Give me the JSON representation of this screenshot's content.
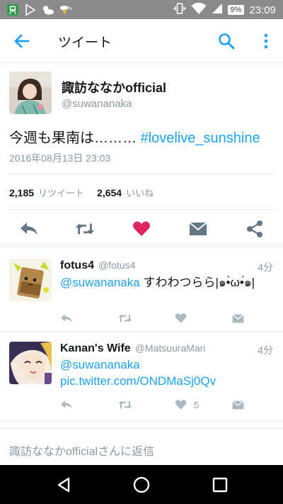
{
  "status_bar": {
    "time": "23:09",
    "battery": "9%",
    "left_icons": [
      "train-icon",
      "play-store-icon",
      "weather-icon",
      "weather-alert-icon"
    ],
    "right_icons": [
      "vibrate-icon",
      "wifi-icon",
      "signal-icon",
      "battery-icon"
    ]
  },
  "app_bar": {
    "title": "ツイート",
    "back_icon": "arrow-left-icon",
    "search_icon": "search-icon",
    "more_icon": "more-vertical-icon",
    "accent": "#1da1f2"
  },
  "main_tweet": {
    "display_name": "諏訪ななかofficial",
    "handle": "@suwananaka",
    "text_prefix": "今週も果南は……… ",
    "hashtag": "#lovelive_sunshine",
    "timestamp": "2016年08月13日 23:03",
    "retweet_count": "2,185",
    "retweet_label": "リツイート",
    "like_count": "2,654",
    "like_label": "いいね",
    "liked": true,
    "like_color": "#e0245e",
    "actions": [
      "reply-icon",
      "retweet-icon",
      "heart-icon",
      "message-icon",
      "share-icon"
    ]
  },
  "replies": [
    {
      "display_name": "fotus4",
      "handle": "@fotus4",
      "time": "4分",
      "mention": "@suwananaka",
      "text": " すわわつらら|๑•̀ω•́๑|",
      "like_count": ""
    },
    {
      "display_name": "Kanan's Wife",
      "handle": "@MatsuuraMari",
      "time": "4分",
      "mention": "@suwananaka",
      "link": " pic.twitter.com/ONDMaSj0Qv",
      "like_count": "5"
    }
  ],
  "reply_box": {
    "placeholder": "諏訪ななかofficialさんに返信"
  },
  "nav_bar": {
    "buttons": [
      "back-triangle-icon",
      "home-circle-icon",
      "recents-square-icon"
    ]
  }
}
